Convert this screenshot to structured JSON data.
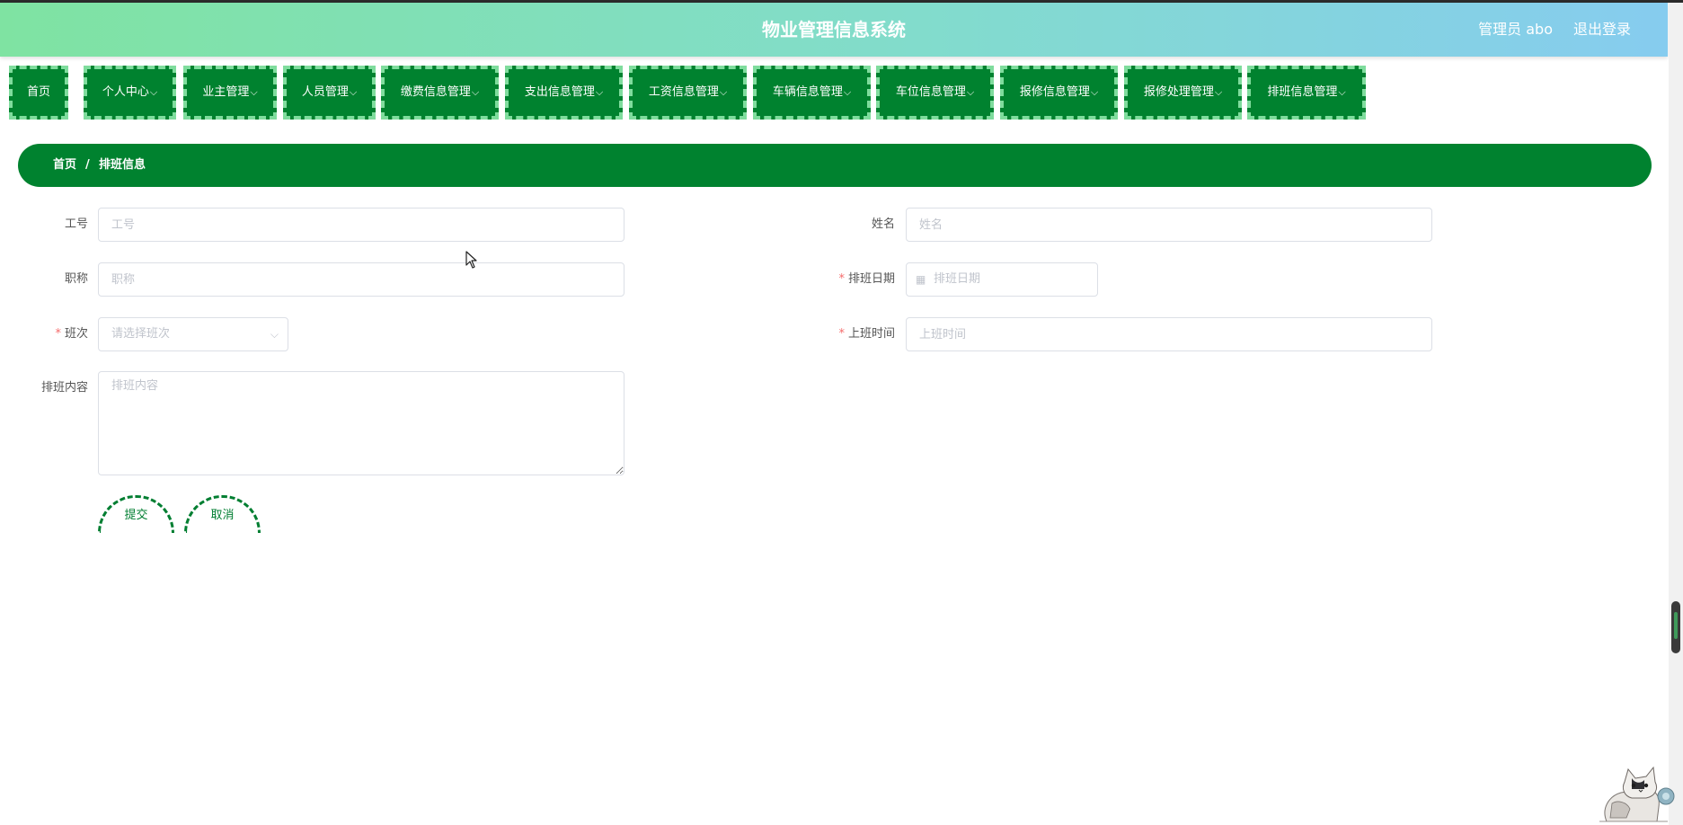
{
  "header": {
    "title": "物业管理信息系统",
    "user": "管理员 abo",
    "logout": "退出登录"
  },
  "nav": [
    {
      "label": "首页",
      "arrow": ""
    },
    {
      "label": "个人中心",
      "arrow": "⌵"
    },
    {
      "label": "业主管理",
      "arrow": "⌵"
    },
    {
      "label": "人员管理",
      "arrow": "⌵"
    },
    {
      "label": "缴费信息管理",
      "arrow": "⌵"
    },
    {
      "label": "支出信息管理",
      "arrow": "⌵"
    },
    {
      "label": "工资信息管理",
      "arrow": "⌵"
    },
    {
      "label": "车辆信息管理",
      "arrow": "⌵"
    },
    {
      "label": "车位信息管理",
      "arrow": "⌵"
    },
    {
      "label": "报修信息管理",
      "arrow": "⌵"
    },
    {
      "label": "报修处理管理",
      "arrow": "⌵"
    },
    {
      "label": "排班信息管理",
      "arrow": "⌵"
    }
  ],
  "breadcrumb": {
    "home": "首页",
    "separator": "/",
    "current": "排班信息"
  },
  "form": {
    "gonghao": {
      "label": "工号",
      "placeholder": "工号",
      "value": ""
    },
    "xingming": {
      "label": "姓名",
      "placeholder": "姓名",
      "value": ""
    },
    "zhicheng": {
      "label": "职称",
      "placeholder": "职称",
      "value": ""
    },
    "paibanriqi": {
      "label": "排班日期",
      "placeholder": "排班日期",
      "required_mark": "*"
    },
    "banci": {
      "label": "班次",
      "placeholder": "请选择班次",
      "required_mark": "*"
    },
    "shangbanshijian": {
      "label": "上班时间",
      "placeholder": "上班时间",
      "required_mark": "*",
      "value": ""
    },
    "paibanneirong": {
      "label": "排班内容",
      "placeholder": "排班内容",
      "value": ""
    }
  },
  "buttons": {
    "submit": "提交",
    "cancel": "取消"
  },
  "colors": {
    "primary_green": "#00822f",
    "nav_border": "#7fdc9d",
    "header_gradient_start": "#7fe3a2",
    "header_gradient_end": "#86ccef",
    "required": "#f56c6c"
  },
  "icons": {
    "dropdown": "chevron-down-icon",
    "calendar": "calendar-icon"
  }
}
